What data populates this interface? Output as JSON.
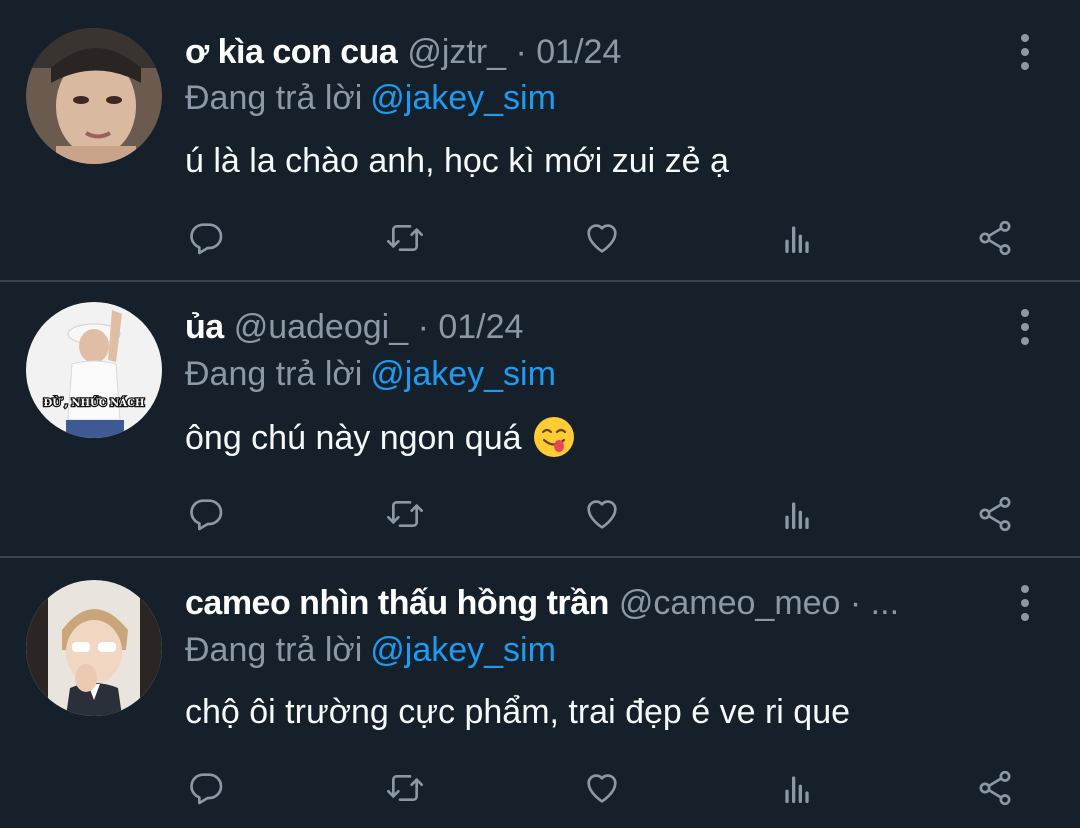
{
  "colors": {
    "background": "#15202b",
    "divider": "#38444d",
    "muted": "#8b98a5",
    "accent": "#1d9bf0",
    "text": "#ffffff"
  },
  "tweets": [
    {
      "display_name": "ơ kìa con cua",
      "handle_meta": "@jztr_ · 01/24",
      "replying_label": "Đang trả lời",
      "reply_mention": "@jakey_sim",
      "text": "ú là la chào anh, học kì mới zui zẻ ạ",
      "avatar_icon": "avatar-photo"
    },
    {
      "display_name": "ủa",
      "handle_meta": "@uadeogi_ · 01/24",
      "replying_label": "Đang trả lời",
      "reply_mention": "@jakey_sim",
      "text": "ông chú này ngon quá",
      "emoji_icon": "face-savoring-food-emoji",
      "avatar_caption": "ĐỪ , NHỨC NÁCH",
      "avatar_icon": "avatar-photo"
    },
    {
      "display_name": "cameo nhìn thấu hồng trần",
      "handle_meta": "@cameo_meo · ...",
      "replying_label": "Đang trả lời",
      "reply_mention": "@jakey_sim",
      "text": "chộ ôi trường cực phẩm, trai đẹp é ve ri que",
      "avatar_icon": "avatar-photo"
    }
  ],
  "action_icons": [
    "reply-icon",
    "retweet-icon",
    "like-icon",
    "views-icon",
    "share-icon"
  ]
}
